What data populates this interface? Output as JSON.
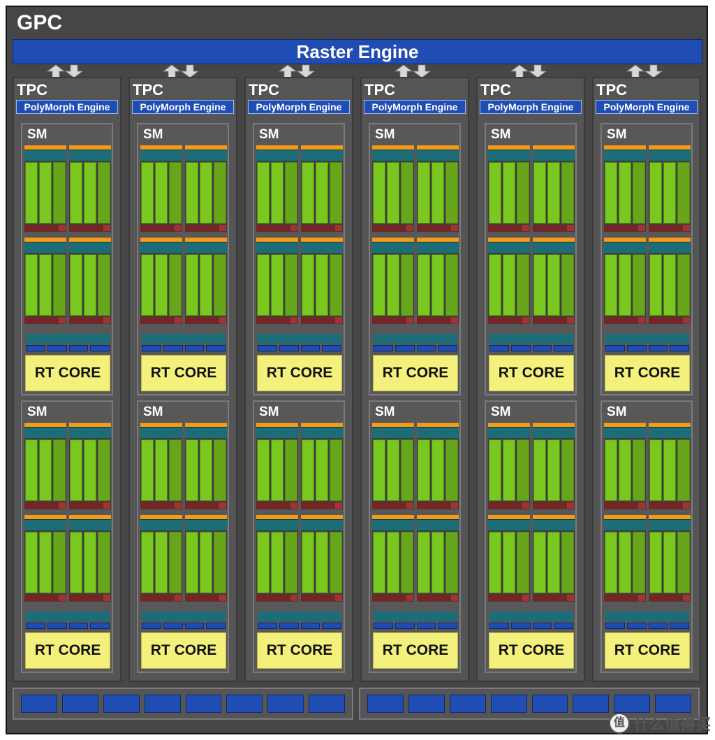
{
  "gpc": {
    "label": "GPC"
  },
  "raster_engine": {
    "label": "Raster Engine"
  },
  "tpc": {
    "label": "TPC",
    "polymorph_label": "PolyMorph Engine",
    "count": 6
  },
  "sm": {
    "label": "SM",
    "rt_core_label": "RT CORE"
  },
  "watermark": {
    "icon": "值",
    "text": "什么值得买"
  },
  "colors": {
    "background": "#464646",
    "raster": "#1f4db3",
    "cuda_core": "#7ac71f",
    "rt_core": "#f3f07c",
    "l0_cache": "#f39b19",
    "warp_scheduler": "#1c6d77",
    "register_file": "#7a2323"
  }
}
